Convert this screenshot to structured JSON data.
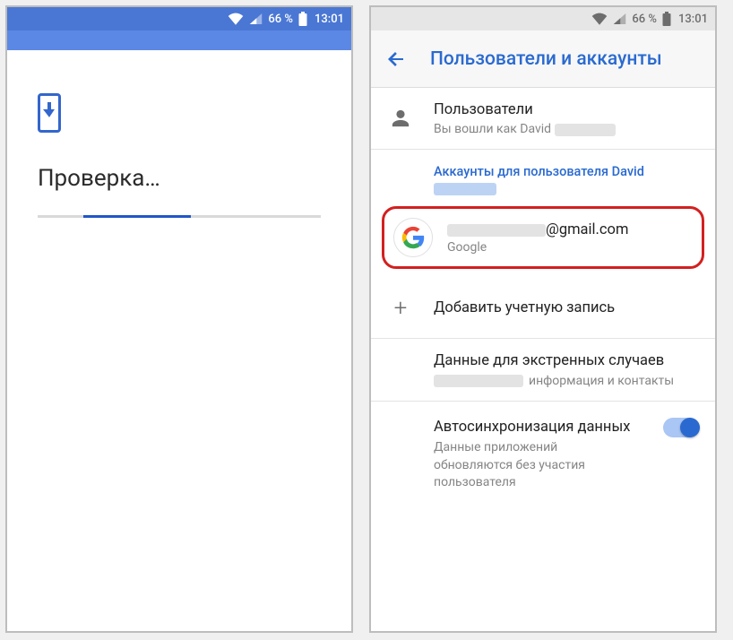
{
  "statusbar": {
    "battery_pct": "66 %",
    "time": "13:01"
  },
  "screen1": {
    "title": "Проверка…"
  },
  "screen2": {
    "appbar_title": "Пользователи и аккаунты",
    "users": {
      "title": "Пользователи",
      "subtitle_prefix": "Вы вошли как David"
    },
    "section_header_prefix": "Аккаунты для пользователя David",
    "account": {
      "email_suffix": "@gmail.com",
      "provider": "Google"
    },
    "add_account": "Добавить учетную запись",
    "emergency": {
      "title": "Данные для экстренных случаев",
      "subtitle_suffix": "информация и контакты"
    },
    "autosync": {
      "title": "Автосинхронизация данных",
      "subtitle": "Данные приложений обновляются без участия пользователя"
    }
  }
}
